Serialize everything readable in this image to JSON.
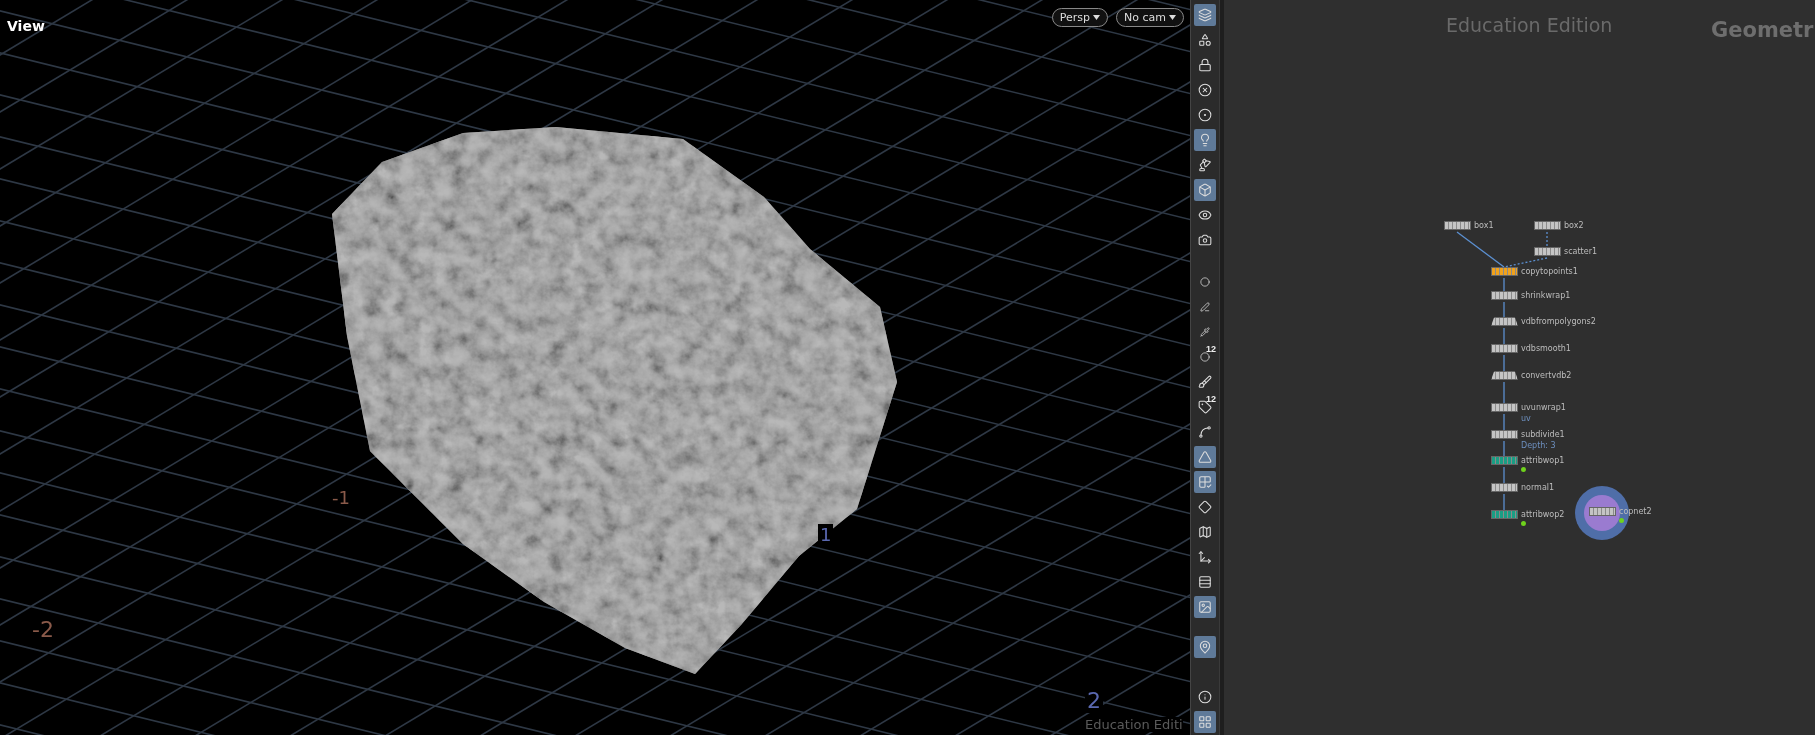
{
  "viewport": {
    "title": "View",
    "camera_menus": [
      {
        "label": "Persp"
      },
      {
        "label": "No cam"
      }
    ],
    "grid_labels": [
      "-2",
      "-1",
      "1",
      "2"
    ],
    "watermark": "Education Editi"
  },
  "toolbar": [
    {
      "on": true
    },
    {
      "on": false
    },
    {
      "on": false
    },
    {
      "on": false
    },
    {
      "on": false
    },
    {
      "on": true
    },
    {
      "on": false
    },
    {
      "on": true
    },
    {
      "on": false
    },
    {
      "on": false
    },
    {
      "on": false
    },
    {
      "on": false
    },
    {
      "on": false
    },
    {
      "on": false,
      "label": "12"
    },
    {
      "on": false
    },
    {
      "on": false,
      "label": "12"
    },
    {
      "on": false
    },
    {
      "on": true
    },
    {
      "on": true
    },
    {
      "on": false
    },
    {
      "on": false
    },
    {
      "on": false
    },
    {
      "on": false
    },
    {
      "on": true
    },
    {
      "on": true
    },
    {
      "on": false
    },
    {
      "on": true
    }
  ],
  "network": {
    "watermark": "Education Edition",
    "context": "Geometr",
    "nodes": [
      {
        "name": "box1",
        "kind": "box",
        "color": "#c4c4c4",
        "flagged": false,
        "current": false
      },
      {
        "name": "box2",
        "kind": "box",
        "color": "#c4c4c4",
        "flagged": false,
        "current": false
      },
      {
        "name": "scatter1",
        "kind": "box",
        "color": "#c4c4c4",
        "flagged": false,
        "current": false
      },
      {
        "name": "copytopoints1",
        "kind": "box",
        "color": "#f0a21c",
        "flagged": false,
        "current": false
      },
      {
        "name": "shrinkwrap1",
        "kind": "box",
        "color": "#c4c4c4",
        "flagged": false,
        "current": false
      },
      {
        "name": "vdbfrompolygons2",
        "kind": "trapezoid",
        "color": "#c4c4c4",
        "flagged": false,
        "current": false
      },
      {
        "name": "vdbsmooth1",
        "kind": "box",
        "color": "#c4c4c4",
        "flagged": false,
        "current": false
      },
      {
        "name": "convertvdb2",
        "kind": "trapezoid",
        "color": "#c4c4c4",
        "flagged": false,
        "current": false
      },
      {
        "name": "uvunwrap1",
        "kind": "box",
        "color": "#c4c4c4",
        "flagged": false,
        "current": false,
        "note": "uv"
      },
      {
        "name": "subdivide1",
        "kind": "box",
        "color": "#c4c4c4",
        "flagged": false,
        "current": false,
        "note": "Depth: 3"
      },
      {
        "name": "attribwop1",
        "kind": "box",
        "color": "#1a9e84",
        "flagged": true,
        "current": false
      },
      {
        "name": "normal1",
        "kind": "box",
        "color": "#c4c4c4",
        "flagged": false,
        "current": false
      },
      {
        "name": "attribwop2",
        "kind": "box",
        "color": "#1a9e84",
        "flagged": true,
        "current": false
      },
      {
        "name": "copnet2",
        "kind": "box",
        "color": "#c4c4c4",
        "flagged": true,
        "current": true
      }
    ]
  }
}
